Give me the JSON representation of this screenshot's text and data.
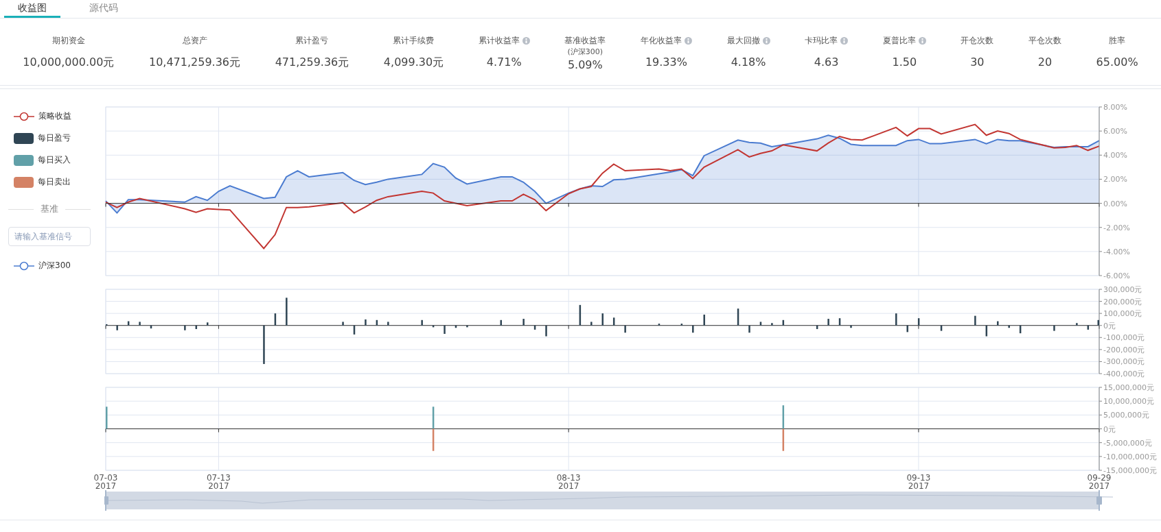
{
  "tabs": [
    {
      "label": "收益图",
      "selected": true
    },
    {
      "label": "源代码",
      "selected": false
    }
  ],
  "stats": [
    {
      "label": "期初资金",
      "value": "10,000,000.00元",
      "info": false
    },
    {
      "label": "总资产",
      "value": "10,471,259.36元",
      "info": false
    },
    {
      "label": "累计盈亏",
      "value": "471,259.36元",
      "info": false
    },
    {
      "label": "累计手续费",
      "value": "4,099.30元",
      "info": false
    },
    {
      "label": "累计收益率",
      "value": "4.71%",
      "info": true
    },
    {
      "label": "基准收益率",
      "sublabel": "(沪深300)",
      "value": "5.09%",
      "info": false
    },
    {
      "label": "年化收益率",
      "value": "19.33%",
      "info": true
    },
    {
      "label": "最大回撤",
      "value": "4.18%",
      "info": true
    },
    {
      "label": "卡玛比率",
      "value": "4.63",
      "info": true
    },
    {
      "label": "夏普比率",
      "value": "1.50",
      "info": true
    },
    {
      "label": "开仓次数",
      "value": "30",
      "info": false
    },
    {
      "label": "平仓次数",
      "value": "20",
      "info": false
    },
    {
      "label": "胜率",
      "value": "65.00%",
      "info": false
    }
  ],
  "legend": {
    "benchmark": {
      "title": "基准",
      "placeholder": "请输入基准信号"
    }
  },
  "charts": [
    {
      "chart_data": {
        "type": "line",
        "grid": true,
        "xlim": [
          "2017-07-03",
          "2017-09-29"
        ],
        "ylim": [
          -6,
          8
        ],
        "yticks": [
          {
            "value": 8,
            "label": "8.00%"
          },
          {
            "value": 6,
            "label": "6.00%"
          },
          {
            "value": 4,
            "label": "4.00%"
          },
          {
            "value": 2,
            "label": "2.00%"
          },
          {
            "value": 0,
            "label": "0.00%"
          },
          {
            "value": -2,
            "label": "-2.00%"
          },
          {
            "value": -4,
            "label": "-4.00%"
          },
          {
            "value": -6,
            "label": "-6.00%"
          }
        ],
        "x": [
          "2017-07-03",
          "2017-07-04",
          "2017-07-05",
          "2017-07-06",
          "2017-07-10",
          "2017-07-11",
          "2017-07-12",
          "2017-07-13",
          "2017-07-14",
          "2017-07-17",
          "2017-07-18",
          "2017-07-19",
          "2017-07-20",
          "2017-07-21",
          "2017-07-24",
          "2017-07-25",
          "2017-07-26",
          "2017-07-27",
          "2017-07-28",
          "2017-07-31",
          "2017-08-01",
          "2017-08-02",
          "2017-08-03",
          "2017-08-04",
          "2017-08-07",
          "2017-08-08",
          "2017-08-09",
          "2017-08-10",
          "2017-08-11",
          "2017-08-13",
          "2017-08-14",
          "2017-08-15",
          "2017-08-16",
          "2017-08-17",
          "2017-08-18",
          "2017-08-21",
          "2017-08-22",
          "2017-08-23",
          "2017-08-24",
          "2017-08-25",
          "2017-08-28",
          "2017-08-29",
          "2017-08-30",
          "2017-08-31",
          "2017-09-01",
          "2017-09-04",
          "2017-09-05",
          "2017-09-06",
          "2017-09-07",
          "2017-09-08",
          "2017-09-11",
          "2017-09-12",
          "2017-09-13",
          "2017-09-14",
          "2017-09-15",
          "2017-09-18",
          "2017-09-19",
          "2017-09-20",
          "2017-09-21",
          "2017-09-22",
          "2017-09-25",
          "2017-09-26",
          "2017-09-27",
          "2017-09-28",
          "2017-09-29"
        ],
        "series": [
          {
            "name": "沪深300",
            "type": "area",
            "color": "#4a7bd0",
            "values": [
              0.2,
              -0.8,
              0.3,
              0.3,
              0.1,
              0.55,
              0.25,
              1.0,
              1.45,
              0.4,
              0.5,
              2.2,
              2.7,
              2.2,
              2.55,
              1.9,
              1.55,
              1.75,
              2.0,
              2.4,
              3.3,
              3.0,
              2.1,
              1.6,
              2.2,
              2.2,
              1.75,
              1.0,
              0.0,
              0.85,
              1.2,
              1.45,
              1.4,
              1.95,
              2.0,
              2.45,
              2.6,
              2.8,
              2.3,
              3.95,
              5.25,
              5.05,
              5.0,
              4.7,
              4.85,
              5.35,
              5.65,
              5.4,
              4.9,
              4.8,
              4.8,
              5.2,
              5.3,
              4.95,
              4.95,
              5.3,
              4.95,
              5.3,
              5.2,
              5.2,
              4.65,
              4.7,
              4.7,
              4.7,
              5.2
            ]
          },
          {
            "name": "策略收益",
            "type": "line",
            "color": "#c23531",
            "values": [
              0.1,
              -0.35,
              0.1,
              0.4,
              -0.45,
              -0.75,
              -0.45,
              -0.5,
              -0.55,
              -3.75,
              -2.6,
              -0.35,
              -0.35,
              -0.3,
              0.05,
              -0.8,
              -0.3,
              0.25,
              0.55,
              1.0,
              0.85,
              0.2,
              0.0,
              -0.2,
              0.2,
              0.2,
              0.75,
              0.3,
              -0.6,
              0.8,
              1.2,
              1.4,
              2.5,
              3.25,
              2.7,
              2.85,
              2.7,
              2.85,
              2.05,
              3.0,
              4.45,
              3.85,
              4.15,
              4.35,
              4.85,
              4.35,
              5.0,
              5.55,
              5.3,
              5.25,
              6.3,
              5.6,
              6.2,
              6.2,
              5.75,
              6.55,
              5.65,
              6.0,
              5.8,
              5.3,
              4.6,
              4.65,
              4.8,
              4.4,
              4.75
            ]
          }
        ]
      }
    },
    {
      "chart_data": {
        "type": "bar",
        "grid": true,
        "xlim": [
          "2017-07-03",
          "2017-09-29"
        ],
        "ylim": [
          -400000,
          300000
        ],
        "yticks": [
          {
            "value": 300000,
            "label": "300,000元"
          },
          {
            "value": 200000,
            "label": "200,000元"
          },
          {
            "value": 100000,
            "label": "100,000元"
          },
          {
            "value": 0,
            "label": "0元"
          },
          {
            "value": -100000,
            "label": "-100,000元"
          },
          {
            "value": -200000,
            "label": "-200,000元"
          },
          {
            "value": -300000,
            "label": "-300,000元"
          },
          {
            "value": -400000,
            "label": "-400,000元"
          }
        ],
        "x": [
          "2017-07-03",
          "2017-07-04",
          "2017-07-05",
          "2017-07-06",
          "2017-07-07",
          "2017-07-10",
          "2017-07-11",
          "2017-07-12",
          "2017-07-17",
          "2017-07-18",
          "2017-07-19",
          "2017-07-24",
          "2017-07-25",
          "2017-07-26",
          "2017-07-27",
          "2017-07-28",
          "2017-07-31",
          "2017-08-01",
          "2017-08-02",
          "2017-08-03",
          "2017-08-04",
          "2017-08-07",
          "2017-08-09",
          "2017-08-10",
          "2017-08-11",
          "2017-08-14",
          "2017-08-15",
          "2017-08-16",
          "2017-08-17",
          "2017-08-18",
          "2017-08-21",
          "2017-08-23",
          "2017-08-24",
          "2017-08-25",
          "2017-08-28",
          "2017-08-29",
          "2017-08-30",
          "2017-08-31",
          "2017-09-01",
          "2017-09-04",
          "2017-09-05",
          "2017-09-06",
          "2017-09-07",
          "2017-09-11",
          "2017-09-12",
          "2017-09-13",
          "2017-09-15",
          "2017-09-18",
          "2017-09-19",
          "2017-09-20",
          "2017-09-21",
          "2017-09-22",
          "2017-09-25",
          "2017-09-27",
          "2017-09-28",
          "2017-09-29"
        ],
        "series": [
          {
            "name": "每日盈亏",
            "color": "#2f4554",
            "values": [
              10000,
              -40000,
              35000,
              30000,
              -25000,
              -40000,
              -30000,
              25000,
              -320000,
              100000,
              230000,
              30000,
              -75000,
              50000,
              45000,
              30000,
              45000,
              -15000,
              -70000,
              -20000,
              -15000,
              45000,
              55000,
              -35000,
              -90000,
              170000,
              30000,
              100000,
              65000,
              -60000,
              15000,
              15000,
              -60000,
              90000,
              140000,
              -60000,
              30000,
              20000,
              45000,
              -30000,
              55000,
              60000,
              -20000,
              100000,
              -55000,
              60000,
              -45000,
              80000,
              -90000,
              35000,
              -20000,
              -65000,
              -45000,
              20000,
              -35000,
              45000
            ]
          }
        ]
      }
    },
    {
      "chart_data": {
        "type": "bar",
        "grid": true,
        "stacked": true,
        "xlim": [
          "2017-07-03",
          "2017-09-29"
        ],
        "ylim": [
          -15000000,
          15000000
        ],
        "xticks": [
          {
            "value": "2017-07-03",
            "label": "07-03 2017"
          },
          {
            "value": "2017-07-13",
            "label": "07-13 2017"
          },
          {
            "value": "2017-08-13",
            "label": "08-13 2017"
          },
          {
            "value": "2017-09-13",
            "label": "09-13 2017"
          },
          {
            "value": "2017-09-29",
            "label": "09-29 2017"
          }
        ],
        "yticks": [
          {
            "value": 15000000,
            "label": "15,000,000元"
          },
          {
            "value": 10000000,
            "label": "10,000,000元"
          },
          {
            "value": 5000000,
            "label": "5,000,000元"
          },
          {
            "value": 0,
            "label": "0元"
          },
          {
            "value": -5000000,
            "label": "-5,000,000元"
          },
          {
            "value": -10000000,
            "label": "-10,000,000元"
          },
          {
            "value": -15000000,
            "label": "-15,000,000元"
          }
        ],
        "x": [
          "2017-07-03",
          "2017-08-01",
          "2017-09-01"
        ],
        "series": [
          {
            "name": "每日买入",
            "color": "#61a0a8",
            "values": [
              8000000,
              8000000,
              8500000
            ]
          },
          {
            "name": "每日卖出",
            "color": "#d48265",
            "values": [
              null,
              -8000000,
              -8000000
            ]
          }
        ]
      }
    }
  ]
}
